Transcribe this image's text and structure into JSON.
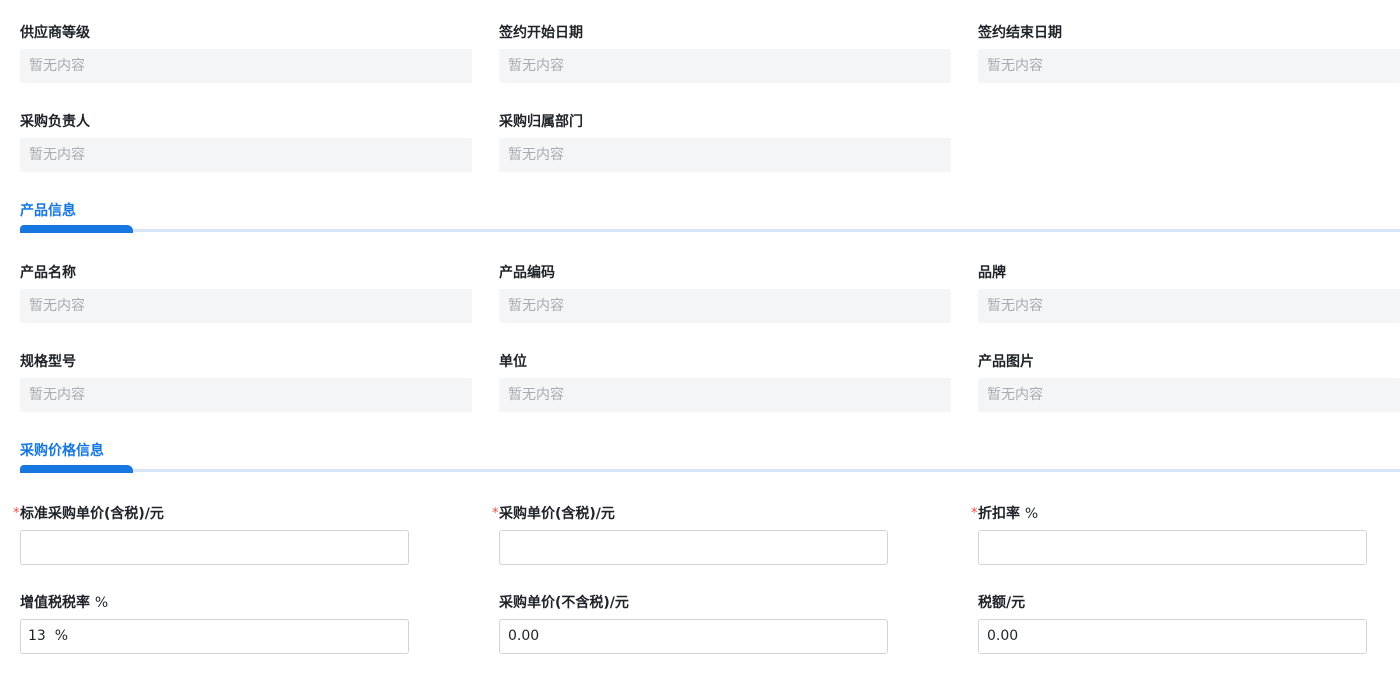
{
  "supplier": {
    "grade": {
      "label": "供应商等级",
      "value": "暂无内容"
    },
    "contract_start": {
      "label": "签约开始日期",
      "value": "暂无内容"
    },
    "contract_end": {
      "label": "签约结束日期",
      "value": "暂无内容"
    },
    "purchase_owner": {
      "label": "采购负责人",
      "value": "暂无内容"
    },
    "purchase_dept": {
      "label": "采购归属部门",
      "value": "暂无内容"
    }
  },
  "product_section": {
    "title": "产品信息",
    "name": {
      "label": "产品名称",
      "value": "暂无内容"
    },
    "code": {
      "label": "产品编码",
      "value": "暂无内容"
    },
    "brand": {
      "label": "品牌",
      "value": "暂无内容"
    },
    "spec": {
      "label": "规格型号",
      "value": "暂无内容"
    },
    "unit": {
      "label": "单位",
      "value": "暂无内容"
    },
    "image": {
      "label": "产品图片",
      "value": "暂无内容"
    }
  },
  "price_section": {
    "title": "采购价格信息",
    "required_mark": "*",
    "std_unit_price": {
      "label": "标准采购单价(含税)/元",
      "value": ""
    },
    "unit_price": {
      "label": "采购单价(含税)/元",
      "value": ""
    },
    "discount": {
      "label": "折扣率",
      "unit": "%",
      "value": ""
    },
    "vat_rate": {
      "label": "增值税税率",
      "unit": "%",
      "value": "13  %"
    },
    "unit_price_ex_tax": {
      "label": "采购单价(不含税)/元",
      "value": "0.00"
    },
    "tax_amount": {
      "label": "税额/元",
      "value": "0.00"
    }
  },
  "colors": {
    "accent": "#1677e0",
    "accent_track": "#d6e6f8",
    "readonly_bg": "#f4f5f7",
    "placeholder": "#a8abb2",
    "required": "#f54a45",
    "border": "#d0d3d9"
  }
}
